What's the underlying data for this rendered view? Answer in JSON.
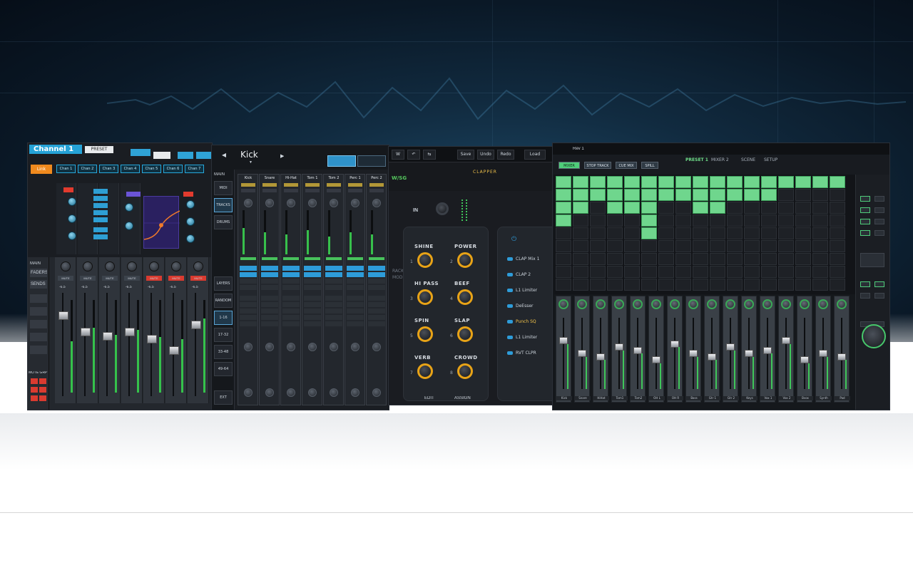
{
  "panel1": {
    "title": "Channel 1",
    "preset_label": "PRESET",
    "link_label": "Link",
    "chan_tabs": [
      "Chan 1",
      "Chan 2",
      "Chan 3",
      "Chan 4",
      "Chan 5",
      "Chan 6",
      "Chan 7"
    ],
    "side_labels": [
      "MAIN",
      "FADERS",
      "SENDS"
    ],
    "strip_buttons": [
      "MUTE",
      "MUTE",
      "MUTE",
      "MUTE",
      "MUTE",
      "MUTE",
      "MUTE"
    ],
    "strip_values": [
      "-6.5",
      "-6.5",
      "-6.5",
      "-6.5",
      "-6.5",
      "-6.5",
      "-6.5"
    ],
    "mute_grp": "MUTE GRP",
    "meter_levels": [
      0.55,
      0.7,
      0.62,
      0.68,
      0.6,
      0.58,
      0.8
    ],
    "fader_levels": [
      0.8,
      0.62,
      0.58,
      0.62,
      0.55,
      0.42,
      0.7
    ]
  },
  "panel2": {
    "title": "Kick",
    "tab_main": "MAIN",
    "left_buttons": [
      "MIDI",
      "TRACKS",
      "DRUMS",
      "LAYERS",
      "RANDOM",
      "1-16",
      "17-32",
      "33-48",
      "49-64",
      "EXT"
    ],
    "channels": [
      "Kick",
      "Snare",
      "Hi-Hat",
      "Tom 1",
      "Tom 2",
      "Perc 1",
      "Perc 2"
    ],
    "meter_levels": [
      0.6,
      0.5,
      0.45,
      0.55,
      0.4,
      0.5,
      0.45
    ]
  },
  "panel3": {
    "bar_buttons": [
      "W",
      "↶",
      "⇆",
      "Save",
      "Undo",
      "Redo",
      "Load"
    ],
    "logo": "W/SG",
    "preset_name": "CLAPPER",
    "in_label": "IN",
    "knobs": [
      {
        "label": "SHINE",
        "num": "1"
      },
      {
        "label": "POWER",
        "num": "2"
      },
      {
        "label": "HI PASS",
        "num": "3"
      },
      {
        "label": "BEEF",
        "num": "4"
      },
      {
        "label": "SPIN",
        "num": "5"
      },
      {
        "label": "SLAP",
        "num": "6"
      },
      {
        "label": "VERB",
        "num": "7"
      },
      {
        "label": "CROWD",
        "num": "8"
      }
    ],
    "list": [
      "CLAP Mix 1",
      "CLAP 2",
      "L1 Limiter",
      "DeEsser",
      "Punch SQ",
      "L1 Limiter",
      "RVT CLPR"
    ],
    "vertical_label": "RACK MODE",
    "bottom_buttons": [
      "EDIT",
      "ASSIGN"
    ],
    "colors": {
      "accent": "#e8a317",
      "logo": "#55c85e"
    }
  },
  "panel4": {
    "top_label": "Rev 1",
    "tabs": [
      "PRESET 1",
      "MIXER 2",
      "SCENE",
      "SETUP"
    ],
    "mode_buttons": [
      "MIXER",
      "STOP TRACK",
      "CUE MIX",
      "SPILL"
    ],
    "strip_names": [
      "Kick",
      "Snare",
      "HiHat",
      "Tom1",
      "Tom2",
      "OH L",
      "OH R",
      "Bass",
      "Gtr 1",
      "Gtr 2",
      "Keys",
      "Vox 1",
      "Vox 2",
      "Bvox",
      "Synth",
      "Pad"
    ],
    "colors": {
      "clip": "#6fd68d",
      "accent": "#4fcd7a"
    }
  }
}
